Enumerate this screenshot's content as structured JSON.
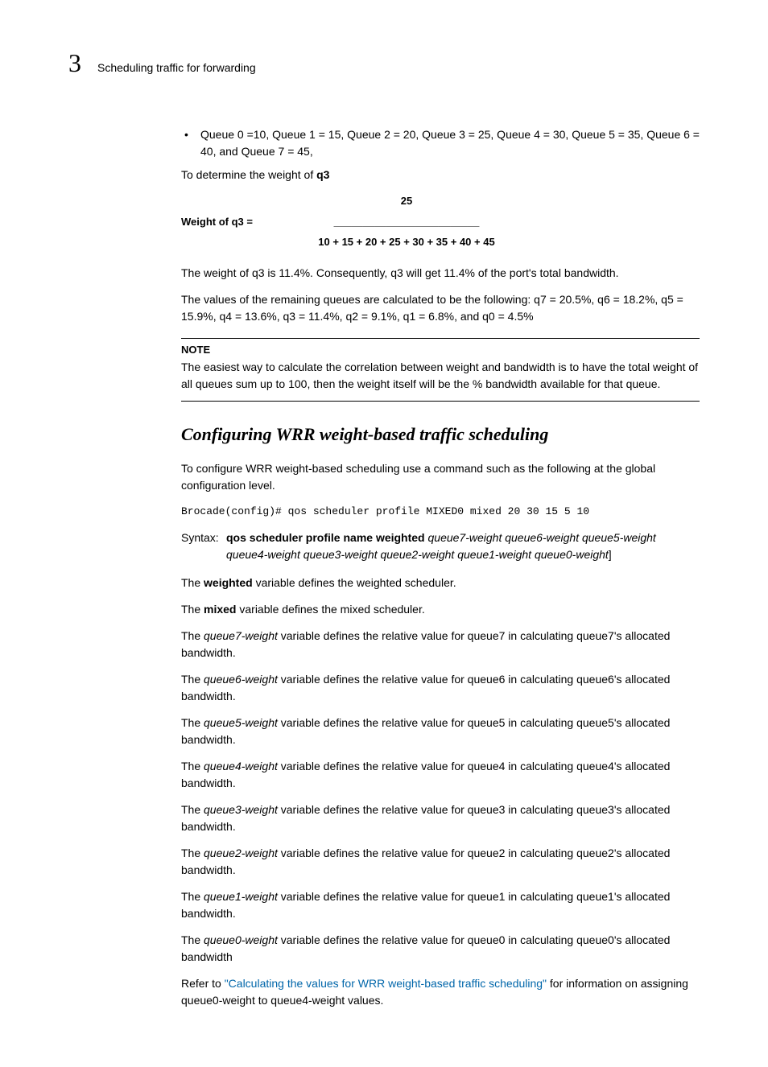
{
  "header": {
    "chapter": "3",
    "section": "Scheduling traffic for forwarding"
  },
  "bullet1": "Queue 0 =10, Queue 1 = 15, Queue 2 = 20, Queue 3 = 25, Queue 4 = 30, Queue 5 = 35, Queue 6 = 40, and Queue 7 = 45,",
  "p_determine": "To determine the weight of ",
  "p_determine_bold": "q3",
  "formula": {
    "left": "Weight of q3 =",
    "numerator": "25",
    "line": "_________________________",
    "denominator": "10 + 15 + 20 + 25 + 30 + 35 + 40 + 45"
  },
  "p_weight_result": "The weight of q3 is 11.4%. Consequently, q3 will get 11.4% of the port's total bandwidth.",
  "p_remaining": "The values of the remaining queues are calculated to be the following: q7 = 20.5%, q6 = 18.2%, q5 = 15.9%, q4 = 13.6%, q3 = 11.4%, q2 = 9.1%, q1 = 6.8%, and q0 = 4.5%",
  "note": {
    "label": "NOTE",
    "body": "The easiest way to calculate the correlation between weight and bandwidth is to have the total weight of all queues sum up to 100, then the weight itself will be the % bandwidth available for that queue."
  },
  "heading2": "Configuring WRR weight-based traffic scheduling",
  "p_config_intro": "To configure WRR weight-based scheduling use a command such as the following at the global configuration level.",
  "code_line": "Brocade(config)# qos scheduler profile MIXED0 mixed 20 30 15 5 10",
  "syntax": {
    "label": "Syntax:",
    "bold_part": "qos scheduler profile name weighted ",
    "italic_part": "queue7-weight queue6-weight queue5-weight queue4-weight queue3-weight queue2-weight queue1-weight queue0-weight",
    "tail": "]"
  },
  "p_weighted_1": "The ",
  "p_weighted_2": "weighted",
  "p_weighted_3": " variable defines the weighted scheduler.",
  "p_mixed_1": "The ",
  "p_mixed_2": "mixed",
  "p_mixed_3": " variable defines the mixed scheduler.",
  "queues": [
    {
      "pre": "The ",
      "var": "queue7-weight",
      "post": " variable defines the relative value for queue7 in calculating queue7's allocated bandwidth."
    },
    {
      "pre": "The ",
      "var": "queue6-weight",
      "post": " variable defines the relative value for queue6 in calculating queue6's allocated bandwidth."
    },
    {
      "pre": "The ",
      "var": "queue5-weight",
      "post": " variable defines the relative value for queue5 in calculating queue5's allocated bandwidth."
    },
    {
      "pre": "The ",
      "var": "queue4-weight",
      "post": " variable defines the relative value for queue4 in calculating queue4's allocated bandwidth."
    },
    {
      "pre": "The ",
      "var": "queue3-weight",
      "post": " variable defines the relative value for queue3 in calculating queue3's allocated bandwidth."
    },
    {
      "pre": "The ",
      "var": "queue2-weight",
      "post": " variable defines the relative value for queue2 in calculating queue2's allocated bandwidth."
    },
    {
      "pre": "The ",
      "var": "queue1-weight",
      "post": " variable defines the relative value for queue1 in calculating queue1's allocated bandwidth."
    },
    {
      "pre": "The ",
      "var": "queue0-weight",
      "post": " variable defines the relative value for queue0 in calculating queue0's allocated bandwidth"
    }
  ],
  "refer": {
    "pre": "Refer to ",
    "link": "\"Calculating the values for WRR weight-based traffic scheduling\"",
    "post": " for information on assigning queue0-weight to queue4-weight values."
  }
}
